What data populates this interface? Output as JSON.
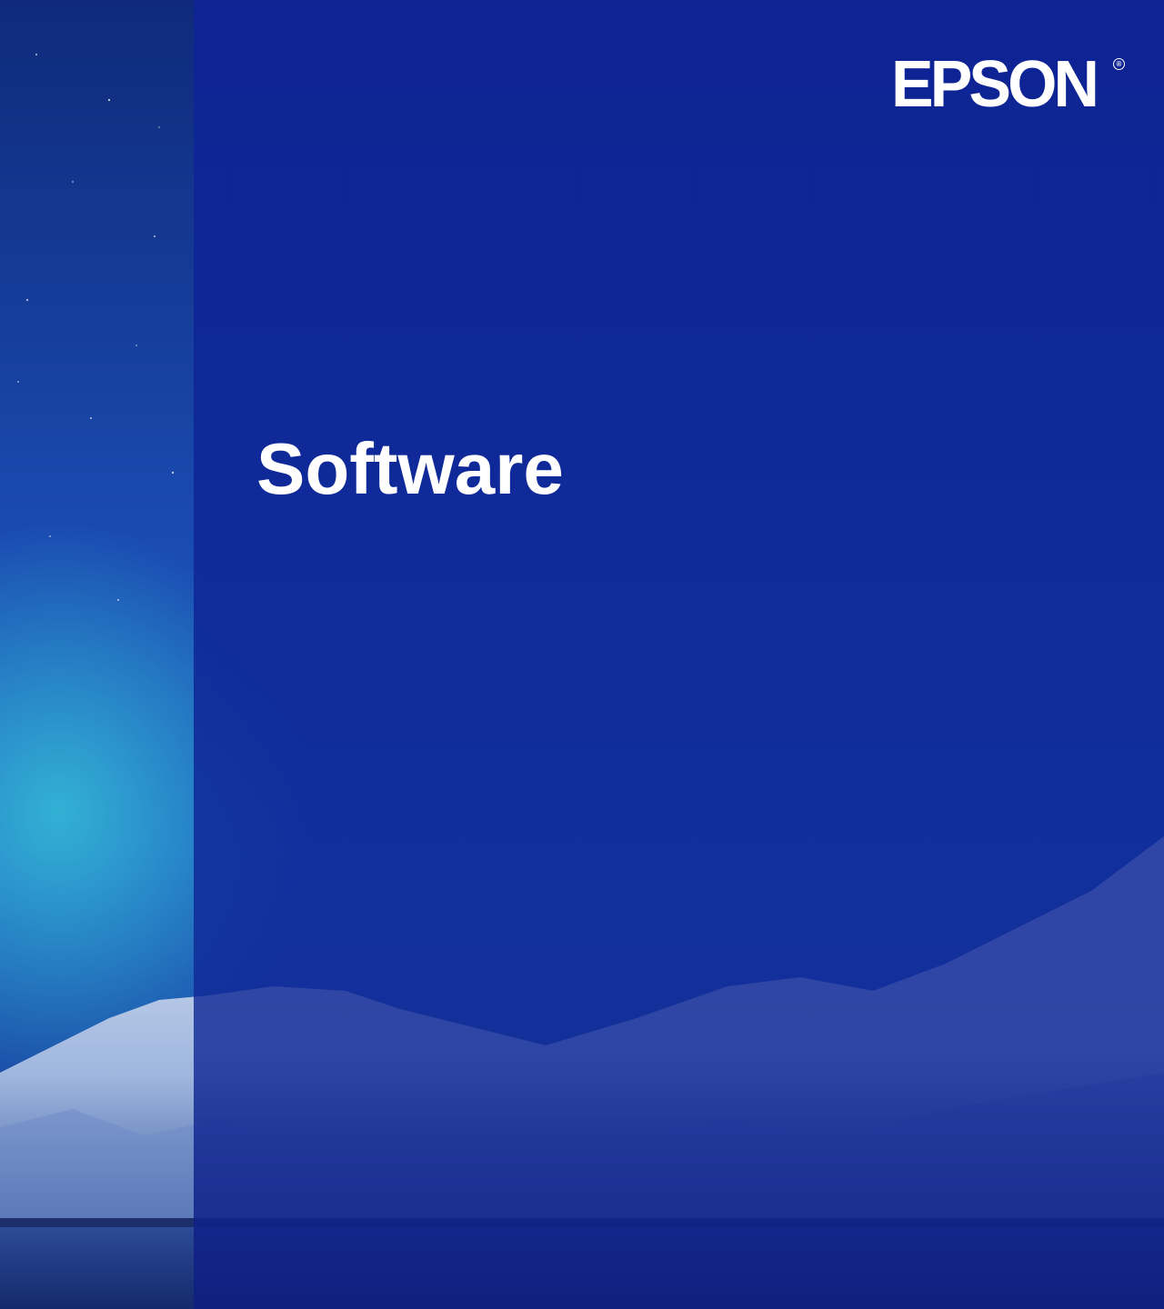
{
  "brand": {
    "logo_text": "EPSON",
    "registered_mark": "®"
  },
  "section": {
    "title": "Software"
  },
  "colors": {
    "overlay": "#0e2396",
    "title_text": "#ffffff",
    "sky_left": "#1a4fb0",
    "aurora": "#2aa6c8"
  }
}
